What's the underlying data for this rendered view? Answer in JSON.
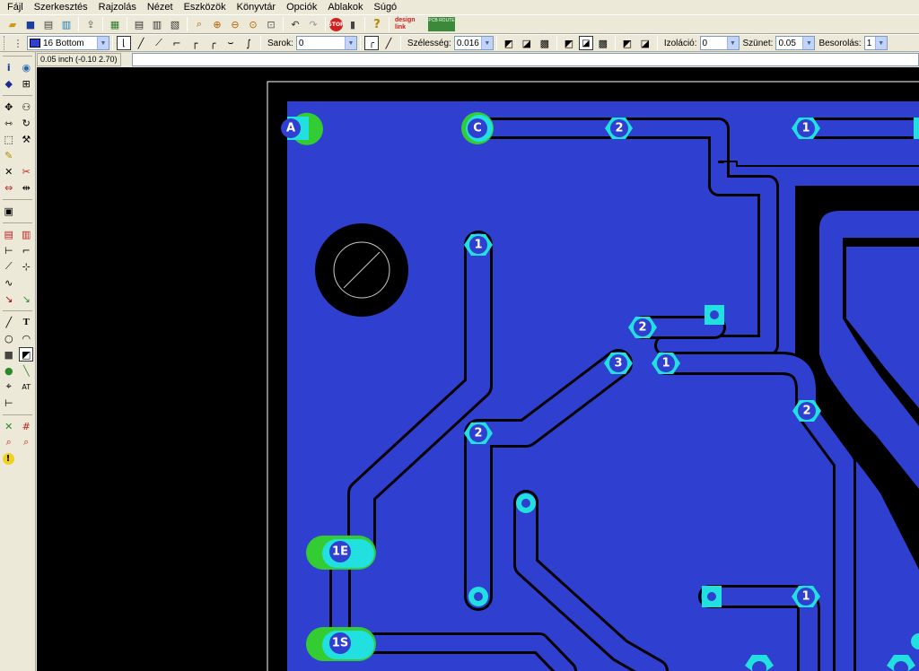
{
  "menu": [
    "Fájl",
    "Szerkesztés",
    "Rajzolás",
    "Nézet",
    "Eszközök",
    "Könyvtár",
    "Opciók",
    "Ablakok",
    "Súgó"
  ],
  "toolbar1": {
    "stop_label": "STOP",
    "help_label": "?",
    "logo1": "design link",
    "logo2": "PCB ROUTE"
  },
  "toolbar2": {
    "layer_value": "16 Bottom",
    "layer_color": "#2f3fd0",
    "corner_label": "Sarok:",
    "corner_value": "0",
    "width_label": "Szélesség:",
    "width_value": "0.016",
    "isolation_label": "Izoláció:",
    "isolation_value": "0",
    "gap_label": "Szünet:",
    "gap_value": "0.05",
    "order_label": "Besorolás:",
    "order_value": "1"
  },
  "coord_readout": "0.05 inch (-0.10 2.70)",
  "colors": {
    "copper_pour": "#2f3fd0",
    "pad": "#22e0e0",
    "pad_highlight": "#33cc33",
    "background": "#000000",
    "board_outline": "#ffffff"
  },
  "pads": [
    {
      "label": "A"
    },
    {
      "label": "C"
    },
    {
      "label": "2"
    },
    {
      "label": "1"
    },
    {
      "label": "1"
    },
    {
      "label": "2"
    },
    {
      "label": "3"
    },
    {
      "label": "1"
    },
    {
      "label": "2"
    },
    {
      "label": "2"
    },
    {
      "label": "1E"
    },
    {
      "label": "1S"
    },
    {
      "label": "1"
    }
  ]
}
